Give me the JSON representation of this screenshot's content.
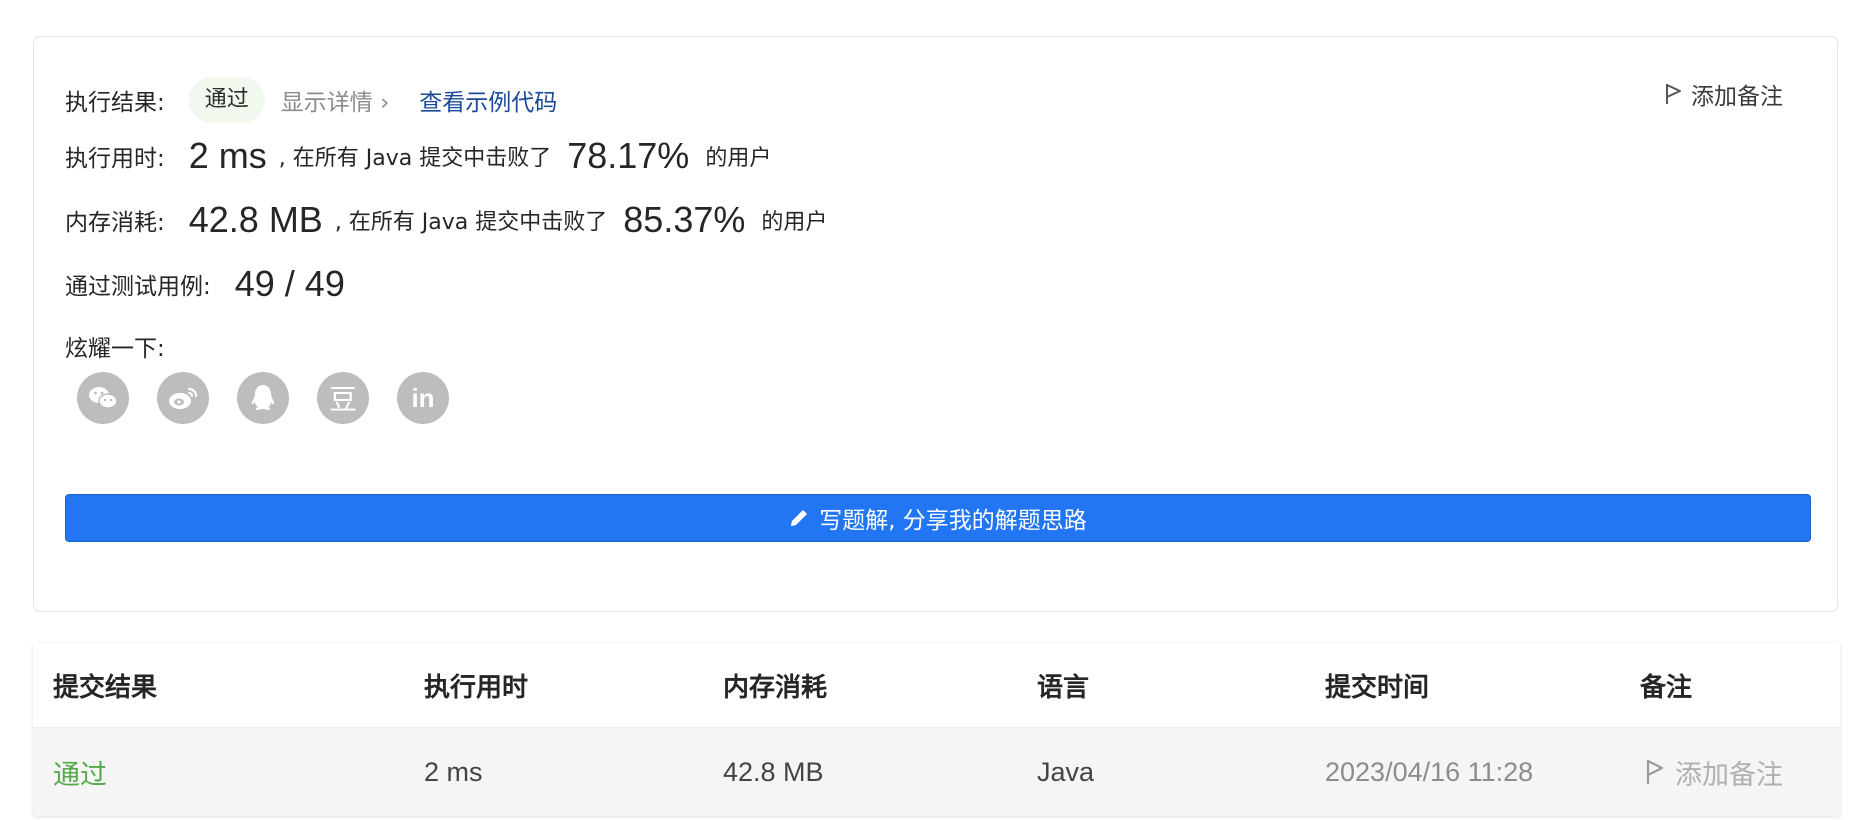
{
  "result": {
    "label": "执行结果:",
    "status": "通过",
    "details_link": "显示详情 ›",
    "example_code_link": "查看示例代码",
    "add_note": "添加备注"
  },
  "runtime": {
    "label": "执行用时:",
    "value": "2 ms",
    "mid_text": ", 在所有 Java 提交中击败了",
    "percent": "78.17%",
    "suffix": "的用户"
  },
  "memory": {
    "label": "内存消耗:",
    "value": "42.8 MB",
    "mid_text": ", 在所有 Java 提交中击败了",
    "percent": "85.37%",
    "suffix": "的用户"
  },
  "tests": {
    "label": "通过测试用例:",
    "value": "49 / 49"
  },
  "share": {
    "label": "炫耀一下:",
    "icons": [
      "wechat-icon",
      "weibo-icon",
      "qq-icon",
      "douban-icon",
      "linkedin-icon"
    ],
    "douban_glyph": "豆",
    "linkedin_glyph": "in"
  },
  "cta": {
    "label": "写题解, 分享我的解题思路"
  },
  "table": {
    "headers": [
      "提交结果",
      "执行用时",
      "内存消耗",
      "语言",
      "提交时间",
      "备注"
    ],
    "rows": [
      {
        "result": "通过",
        "runtime": "2 ms",
        "memory": "42.8 MB",
        "language": "Java",
        "time": "2023/04/16 11:28",
        "note": "添加备注"
      }
    ]
  },
  "colors": {
    "accent": "#2276f3",
    "pass_green": "#55a84b",
    "link_blue": "#1a4a9a"
  }
}
